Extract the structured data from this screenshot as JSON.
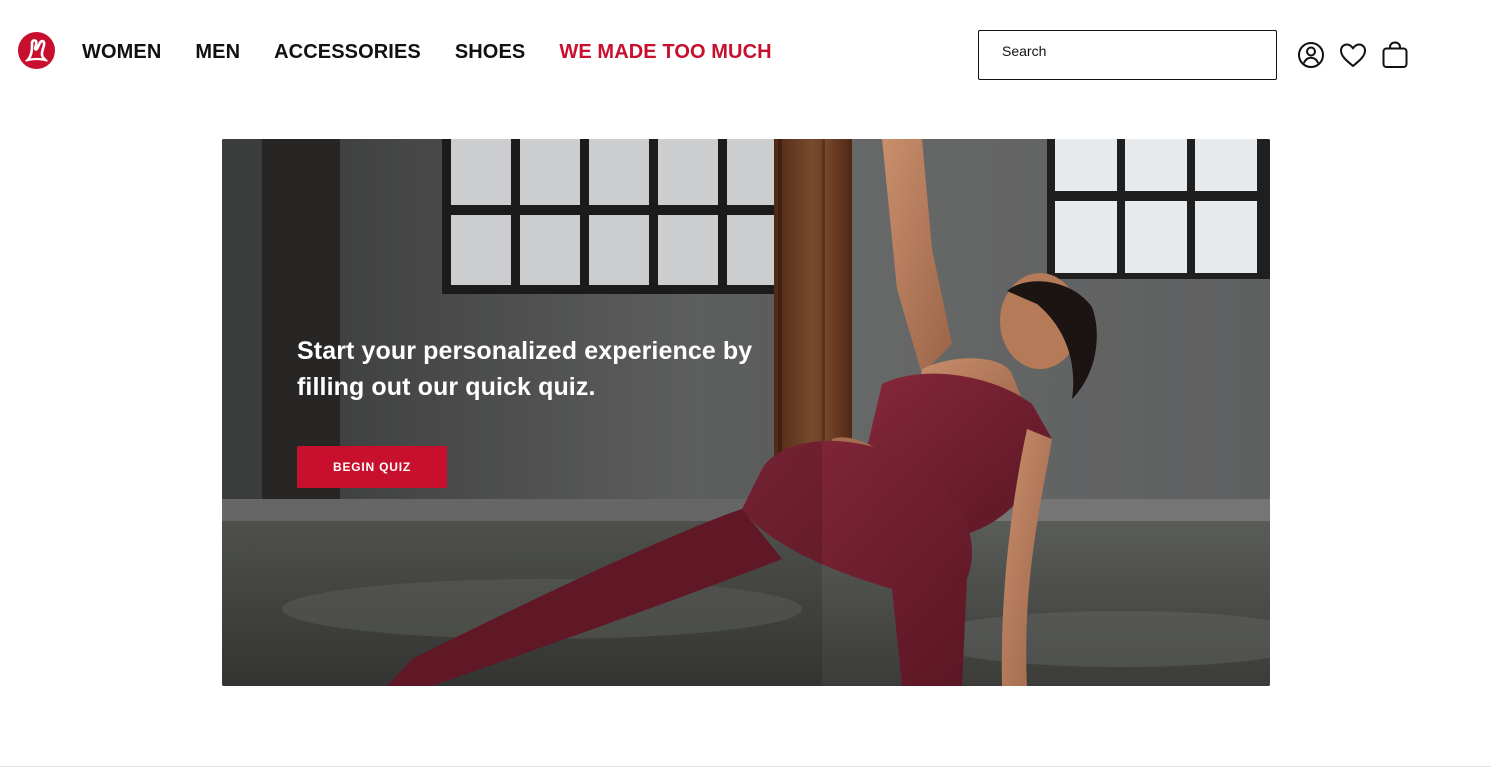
{
  "brand": {
    "logo_icon": "lululemon-logo-icon",
    "accent_color": "#c8102e"
  },
  "nav": {
    "items": [
      {
        "label": "WOMEN"
      },
      {
        "label": "MEN"
      },
      {
        "label": "ACCESSORIES"
      },
      {
        "label": "SHOES"
      },
      {
        "label": "WE MADE TOO MUCH"
      }
    ]
  },
  "search": {
    "placeholder": "Search",
    "value": ""
  },
  "header_icons": {
    "account": "account-icon",
    "wishlist": "heart-icon",
    "bag": "shopping-bag-icon"
  },
  "hero": {
    "headline": "Start your personalized experience by filling out our quick quiz.",
    "cta_label": "BEGIN QUIZ",
    "image_subject": "woman in burgundy yoga set stretching in a loft studio"
  }
}
